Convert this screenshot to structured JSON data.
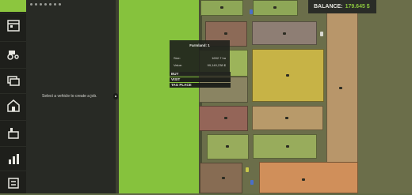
{
  "balance": {
    "label": "BALANCE:",
    "amount": "179.645 $"
  },
  "panel": {
    "message": "Select a vehicle to create a job."
  },
  "sidebar": {
    "items": [
      {
        "icon": "calendar-icon"
      },
      {
        "icon": "tractor-icon"
      },
      {
        "icon": "money-icon"
      },
      {
        "icon": "farm-icon"
      },
      {
        "icon": "production-icon"
      },
      {
        "icon": "statistics-icon"
      },
      {
        "icon": "help-icon"
      }
    ]
  },
  "farmland_popup": {
    "title": "Farmland: 1",
    "size_label": "Size:",
    "size_value": "1692.7 ha",
    "value_label": "Value:",
    "value_value": "99,140,238 $"
  },
  "actions": {
    "buy": "BUY",
    "visit": "VISIT",
    "tag_place": "TAG PLACE"
  },
  "colors": {
    "accent": "#8cc63e",
    "selected_field": "#86c23d"
  }
}
